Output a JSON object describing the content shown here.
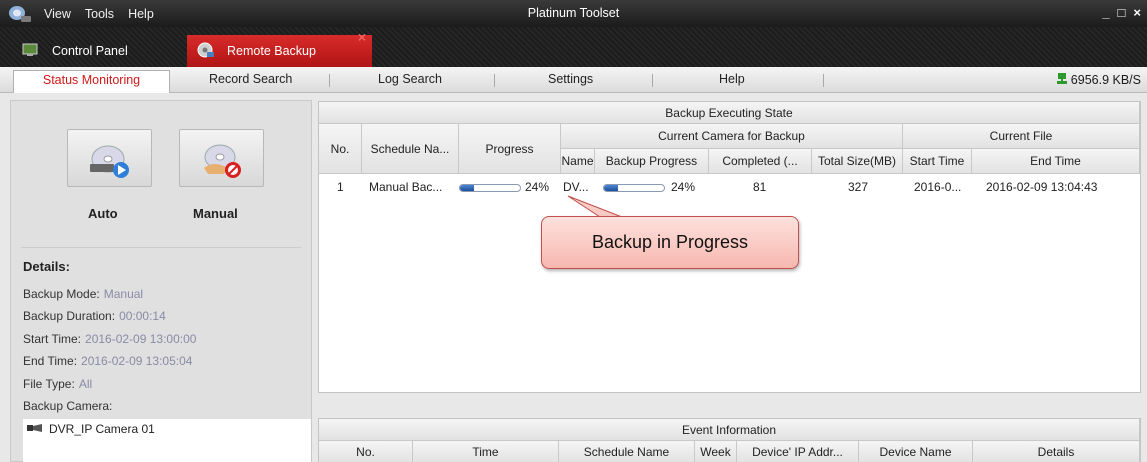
{
  "titlebar": {
    "menu": [
      "View",
      "Tools",
      "Help"
    ],
    "title": "Platinum Toolset",
    "controls": [
      "_",
      "□",
      "×"
    ]
  },
  "tabs": {
    "control_panel": "Control Panel",
    "remote_backup": "Remote Backup"
  },
  "subtabs": {
    "status_monitoring": "Status Monitoring",
    "record_search": "Record Search",
    "log_search": "Log Search",
    "settings": "Settings",
    "help": "Help",
    "speed": "6956.9 KB/S"
  },
  "left": {
    "auto_label": "Auto",
    "manual_label": "Manual",
    "details_title": "Details:",
    "backup_mode_label": "Backup Mode:",
    "backup_mode_value": "Manual",
    "duration_label": "Backup Duration:",
    "duration_value": "00:00:14",
    "start_label": "Start Time:",
    "start_value": "2016-02-09 13:00:00",
    "end_label": "End Time:",
    "end_value": "2016-02-09 13:05:04",
    "filetype_label": "File Type:",
    "filetype_value": "All",
    "camera_label": "Backup Camera:",
    "camera_item": "DVR_IP Camera 01"
  },
  "backup_table": {
    "title": "Backup Executing State",
    "group_camera": "Current  Camera for Backup",
    "group_file": "Current File",
    "col_no": "No.",
    "col_schedule": "Schedule Na...",
    "col_progress": "Progress",
    "col_name": "Name",
    "col_backup_progress": "Backup Progress",
    "col_completed": "Completed (...",
    "col_total": "Total Size(MB)",
    "col_start": "Start Time",
    "col_end": "End Time",
    "row": {
      "no": "1",
      "schedule": "Manual Bac...",
      "progress": 0.24,
      "progress_text": "24%",
      "name": "DV...",
      "backup_progress": 0.24,
      "backup_progress_text": "24%",
      "completed": "81",
      "total": "327",
      "start": "2016-0...",
      "end": "2016-02-09 13:04:43"
    }
  },
  "event_table": {
    "title": "Event Information",
    "col_no": "No.",
    "col_time": "Time",
    "col_schedule": "Schedule Name",
    "col_week": "Week",
    "col_ip": "Device' IP Addr...",
    "col_device": "Device Name",
    "col_details": "Details"
  },
  "callout": "Backup in Progress",
  "colors": {
    "accent_red": "#d01818",
    "progress_blue": "#1c4f9c",
    "speed_green": "#2e9a2e"
  }
}
